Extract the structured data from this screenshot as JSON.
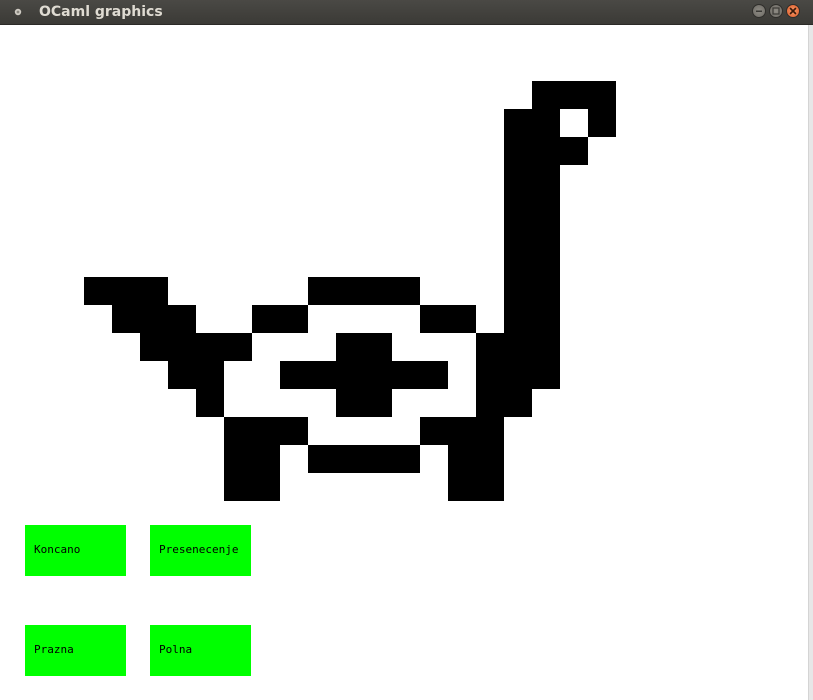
{
  "window": {
    "title": "OCaml graphics",
    "icon": "app-dot-icon",
    "controls": [
      "minimize-icon",
      "maximize-icon",
      "close-icon"
    ]
  },
  "drawing": {
    "subject": "pixel-art-bird",
    "fill_color": "#000000",
    "background_color": "#ffffff"
  },
  "buttons": {
    "color": "#00ff00",
    "koncano": "Koncano",
    "presenecenje": "Presenecenje",
    "prazna": "Prazna",
    "polna": "Polna"
  }
}
